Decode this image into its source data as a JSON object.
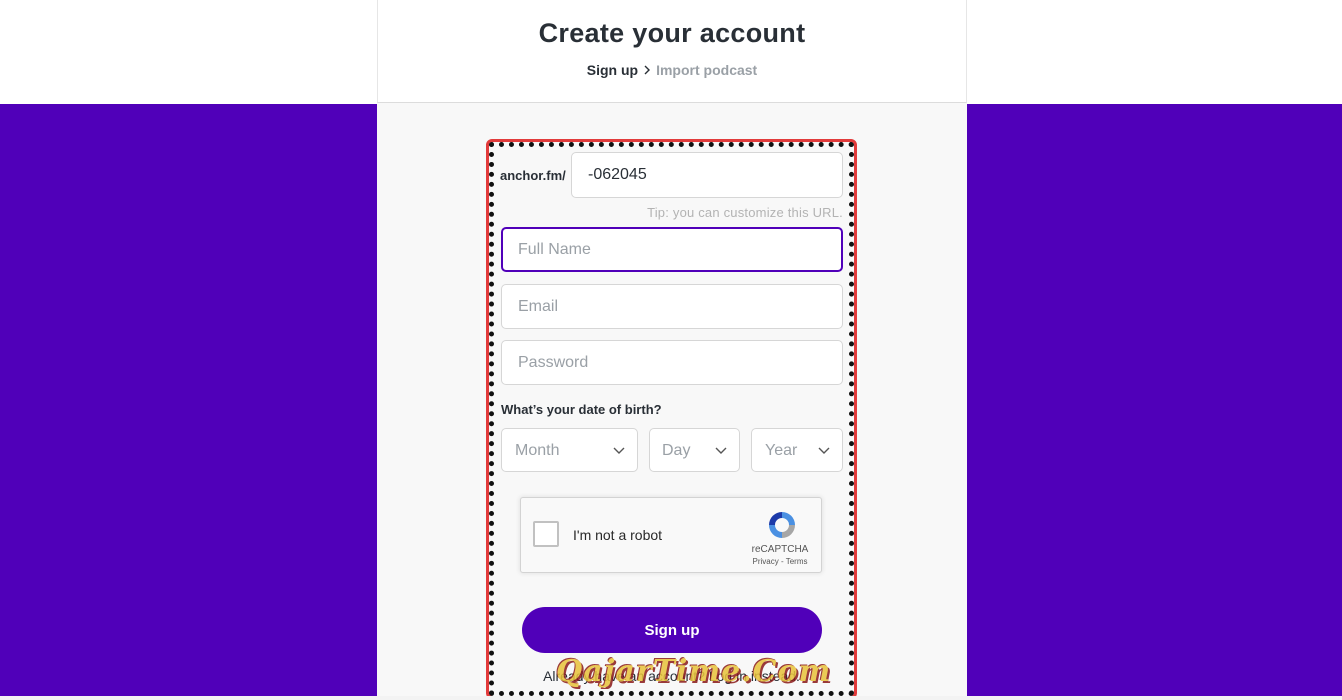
{
  "header": {
    "title": "Create your account",
    "breadcrumb": {
      "current": "Sign up",
      "next": "Import podcast"
    }
  },
  "form": {
    "url_prefix": "anchor.fm/",
    "url_value": "-062045",
    "url_tip": "Tip: you can customize this URL.",
    "full_name_placeholder": "Full Name",
    "email_placeholder": "Email",
    "password_placeholder": "Password",
    "dob_label": "What’s your date of birth?",
    "month_placeholder": "Month",
    "day_placeholder": "Day",
    "year_placeholder": "Year",
    "recaptcha": {
      "label": "I'm not a robot",
      "brand": "reCAPTCHA",
      "links": "Privacy - Terms"
    },
    "submit_label": "Sign up",
    "login_note_prefix": "Already have an account?",
    "login_link": "Log in instead."
  },
  "watermark": "QajarTime.Com",
  "colors": {
    "brand_purple": "#5000b9",
    "highlight_outline": "#e23b3b"
  }
}
